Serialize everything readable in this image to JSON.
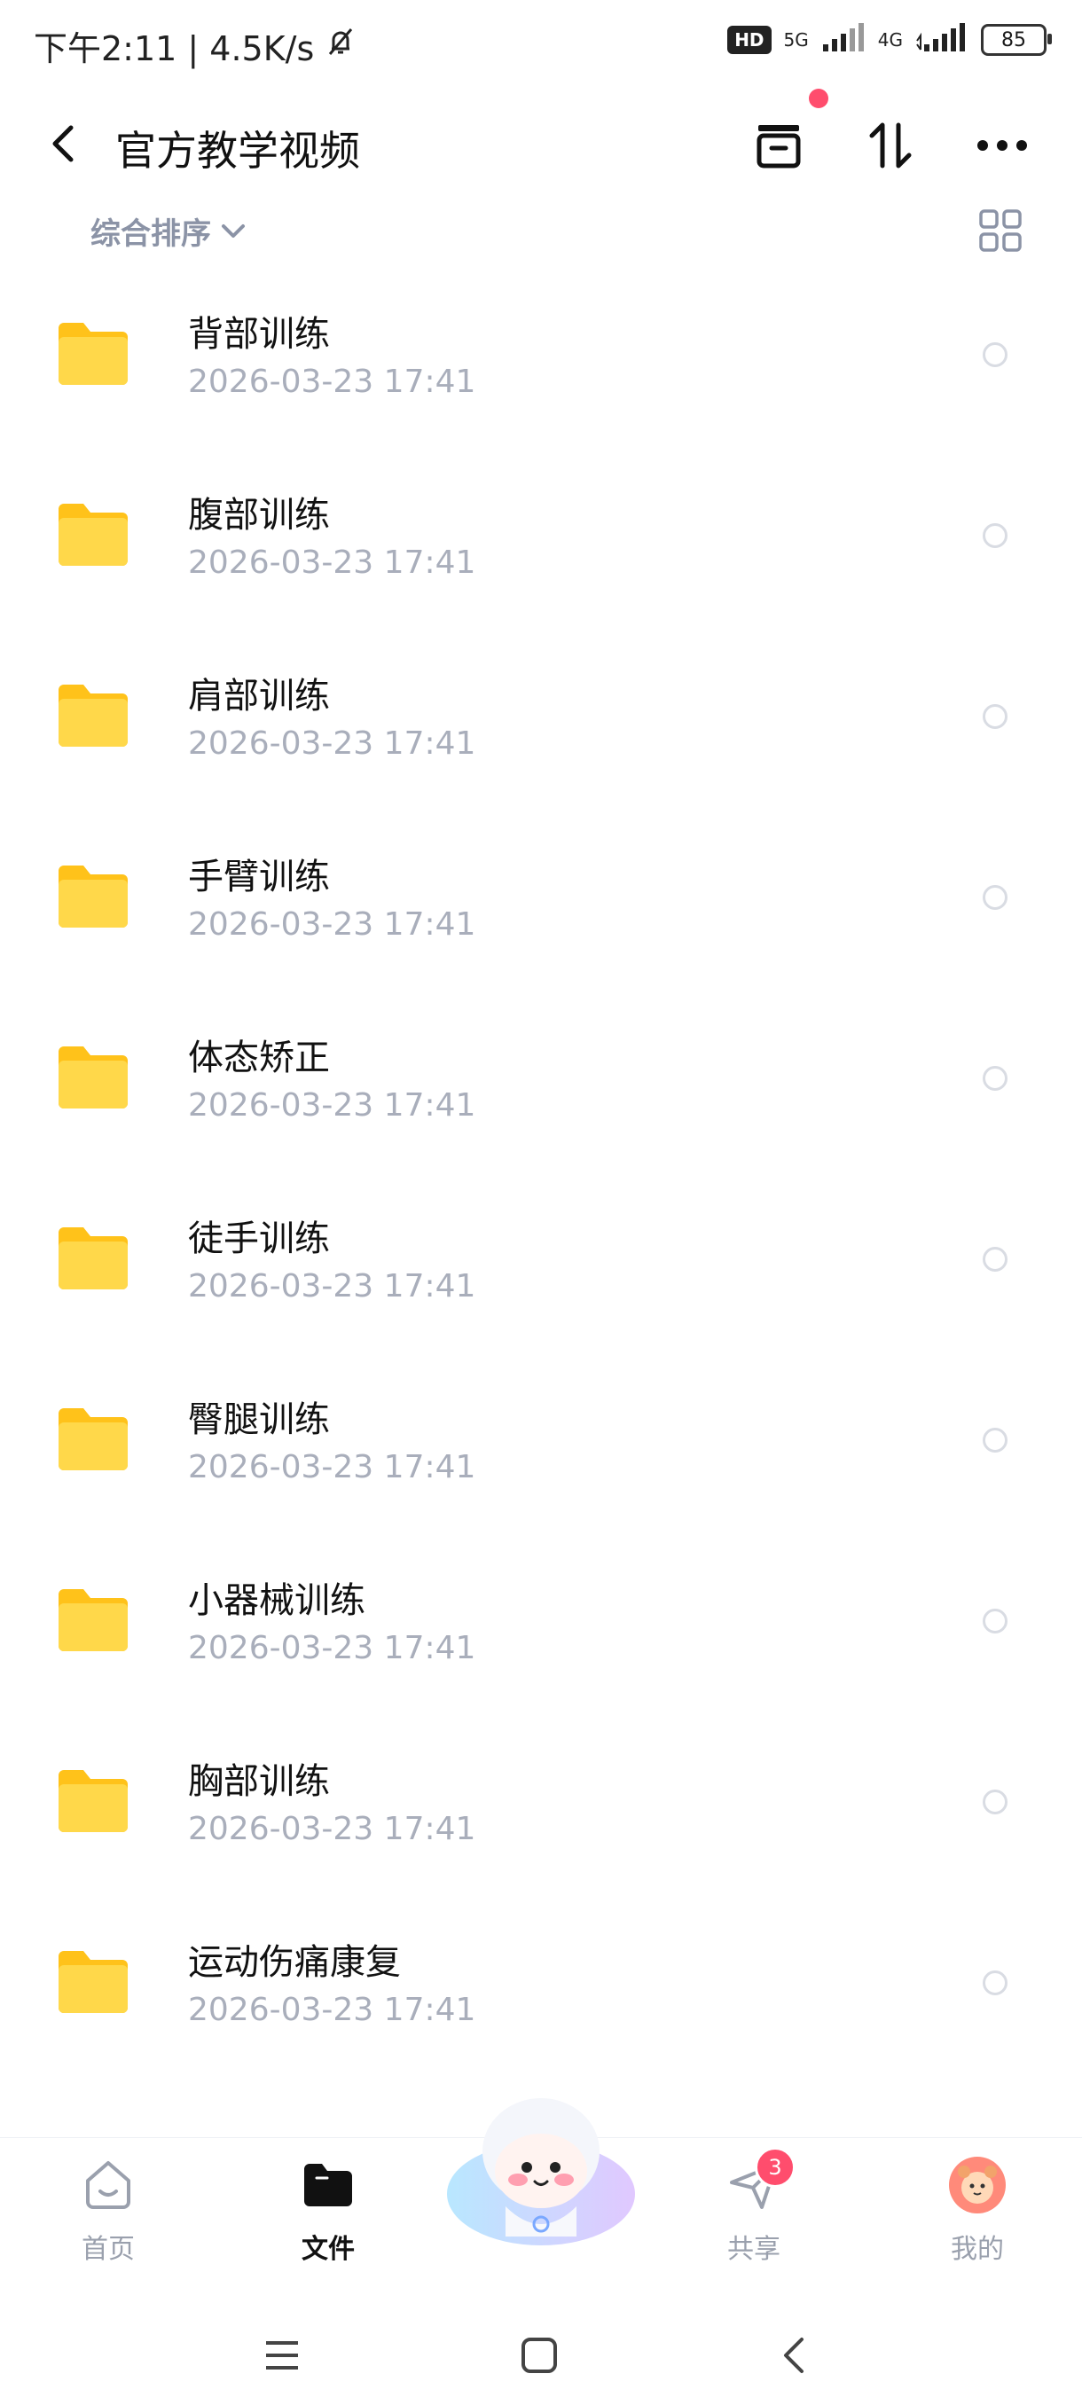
{
  "status_bar": {
    "left_text": "下午2:11 | 4.5K/s",
    "hd_label": "HD",
    "network_5g": "5G",
    "network_4g": "4G",
    "battery": "85"
  },
  "header": {
    "title": "官方教学视频"
  },
  "toolbar": {
    "sort_label": "综合排序"
  },
  "files": [
    {
      "name": "背部训练",
      "date": "2026-03-23  17:41"
    },
    {
      "name": "腹部训练",
      "date": "2026-03-23  17:41"
    },
    {
      "name": "肩部训练",
      "date": "2026-03-23  17:41"
    },
    {
      "name": "手臂训练",
      "date": "2026-03-23  17:41"
    },
    {
      "name": "体态矫正",
      "date": "2026-03-23  17:41"
    },
    {
      "name": "徒手训练",
      "date": "2026-03-23  17:41"
    },
    {
      "name": "臀腿训练",
      "date": "2026-03-23  17:41"
    },
    {
      "name": "小器械训练",
      "date": "2026-03-23  17:41"
    },
    {
      "name": "胸部训练",
      "date": "2026-03-23  17:41"
    },
    {
      "name": "运动伤痛康复",
      "date": "2026-03-23  17:41"
    }
  ],
  "bottom_nav": {
    "home": "首页",
    "files": "文件",
    "share": "共享",
    "share_badge": "3",
    "mine": "我的"
  },
  "colors": {
    "folder_yellow": "#ffd233",
    "accent_red": "#ff4d6d",
    "muted_text": "#a9aebb"
  }
}
